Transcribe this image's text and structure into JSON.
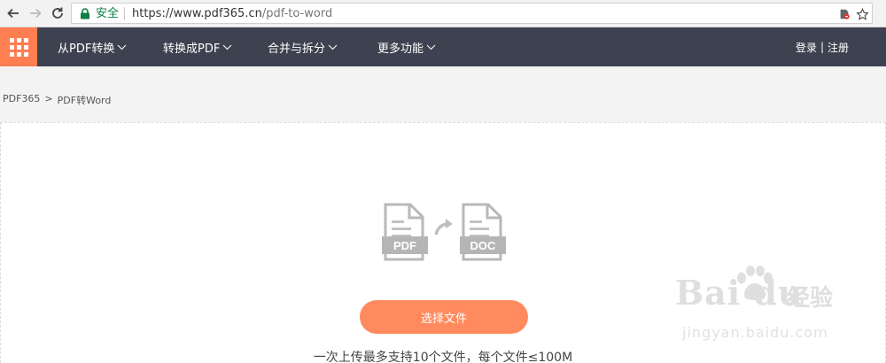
{
  "browser": {
    "secure_label": "安全",
    "url_host": "https://www.pdf365.cn",
    "url_path": "/pdf-to-word",
    "icons": [
      "back-icon",
      "forward-icon",
      "reload-icon",
      "lock-icon",
      "extension-icon",
      "star-icon"
    ]
  },
  "nav": {
    "menu": [
      {
        "label": "从PDF转换"
      },
      {
        "label": "转换成PDF"
      },
      {
        "label": "合并与拆分"
      },
      {
        "label": "更多功能"
      }
    ],
    "login": "登录",
    "separator": "|",
    "register": "注册"
  },
  "breadcrumb": {
    "home": "PDF365",
    "arrow": ">",
    "current": "PDF转Word"
  },
  "upload": {
    "from_label": "PDF",
    "to_label": "DOC",
    "button": "选择文件",
    "hint": "一次上传最多支持10个文件，每个文件≤100M"
  },
  "watermark": {
    "logo_text": "Bai du",
    "jingyan": "经验",
    "site": "jingyan.baidu.com"
  },
  "colors": {
    "accent": "#ff8a5e",
    "nav_bg": "#3e4250",
    "secure_green": "#0b8043"
  }
}
